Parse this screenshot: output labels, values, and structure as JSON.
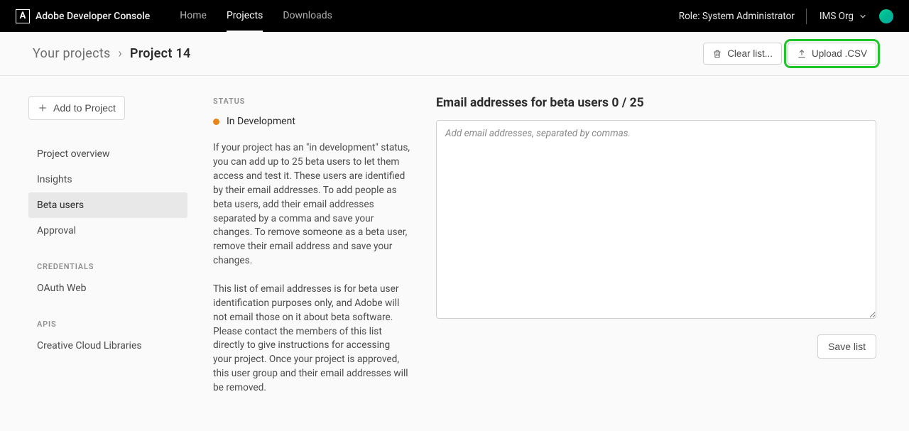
{
  "brand": "Adobe Developer Console",
  "nav": {
    "items": [
      {
        "label": "Home",
        "active": false
      },
      {
        "label": "Projects",
        "active": true
      },
      {
        "label": "Downloads",
        "active": false
      }
    ],
    "role": "Role: System Administrator",
    "org": "IMS Org"
  },
  "breadcrumb": {
    "parent": "Your projects",
    "current": "Project 14"
  },
  "actions": {
    "clear": "Clear list...",
    "upload": "Upload .CSV"
  },
  "sidebar": {
    "add": "Add to Project",
    "items": [
      {
        "label": "Project overview",
        "active": false
      },
      {
        "label": "Insights",
        "active": false
      },
      {
        "label": "Beta users",
        "active": true
      },
      {
        "label": "Approval",
        "active": false
      }
    ],
    "credentials_label": "CREDENTIALS",
    "credentials": [
      {
        "label": "OAuth Web"
      }
    ],
    "apis_label": "APIS",
    "apis": [
      {
        "label": "Creative Cloud Libraries"
      }
    ]
  },
  "status": {
    "heading": "STATUS",
    "value": "In Development",
    "para1": "If your project has an \"in development\" status, you can add up to 25 beta users to let them access and test it. These users are identified by their email addresses. To add people as beta users, add their email addresses separated by a comma and save your changes. To remove someone as a beta user, remove their email address and save your changes.",
    "para2": "This list of email addresses is for beta user identification purposes only, and Adobe will not email those on it about beta software. Please contact the members of this list directly to give instructions for accessing your project. Once your project is approved, this user group and their email addresses will be removed."
  },
  "content": {
    "title": "Email addresses for beta users 0 / 25",
    "placeholder": "Add email addresses, separated by commas.",
    "save": "Save list"
  }
}
